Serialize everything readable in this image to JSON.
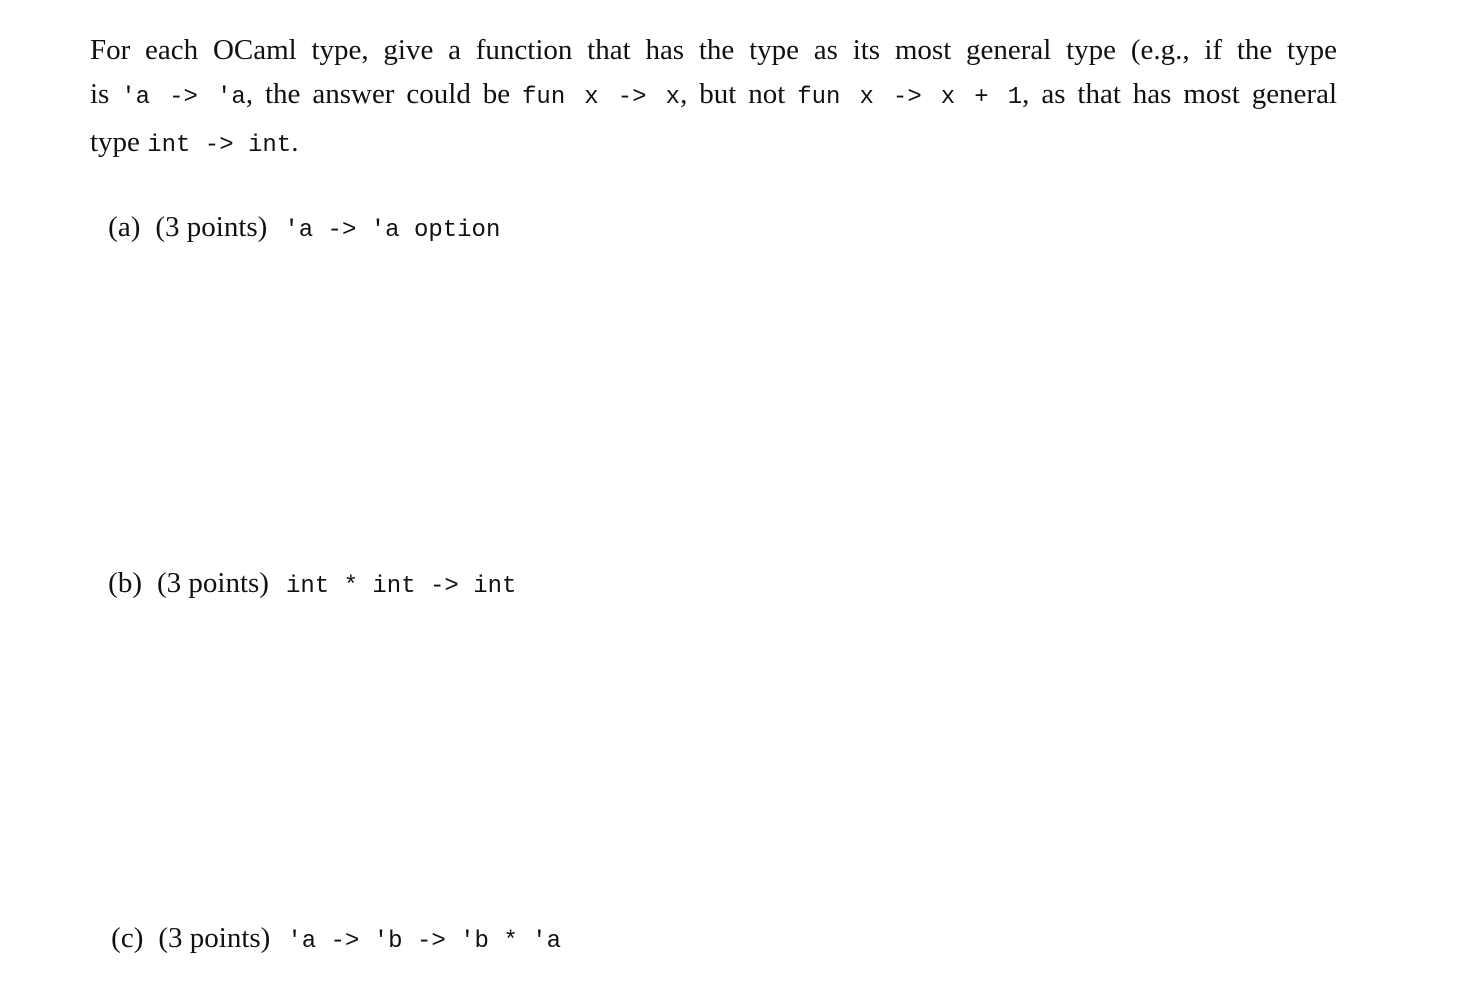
{
  "intro": {
    "line1": "For each OCaml type, give a function that has the type as its most general type (e.g., if the type",
    "line2_text1": "is ",
    "line2_code1": "'a -> 'a",
    "line2_text2": ", the answer could be ",
    "line2_code2": "fun x -> x",
    "line2_text3": ", but not ",
    "line2_code3": "fun x -> x + 1",
    "line2_text4": ", as that has most general",
    "line3_text1": "type ",
    "line3_code1": "int -> int",
    "line3_text2": "."
  },
  "questions": [
    {
      "label": "(a)",
      "points": "(3 points)",
      "type": "'a -> 'a option"
    },
    {
      "label": "(b)",
      "points": "(3 points)",
      "type": "int * int -> int"
    },
    {
      "label": "(c)",
      "points": "(3 points)",
      "type": "'a -> 'b -> 'b * 'a"
    }
  ]
}
